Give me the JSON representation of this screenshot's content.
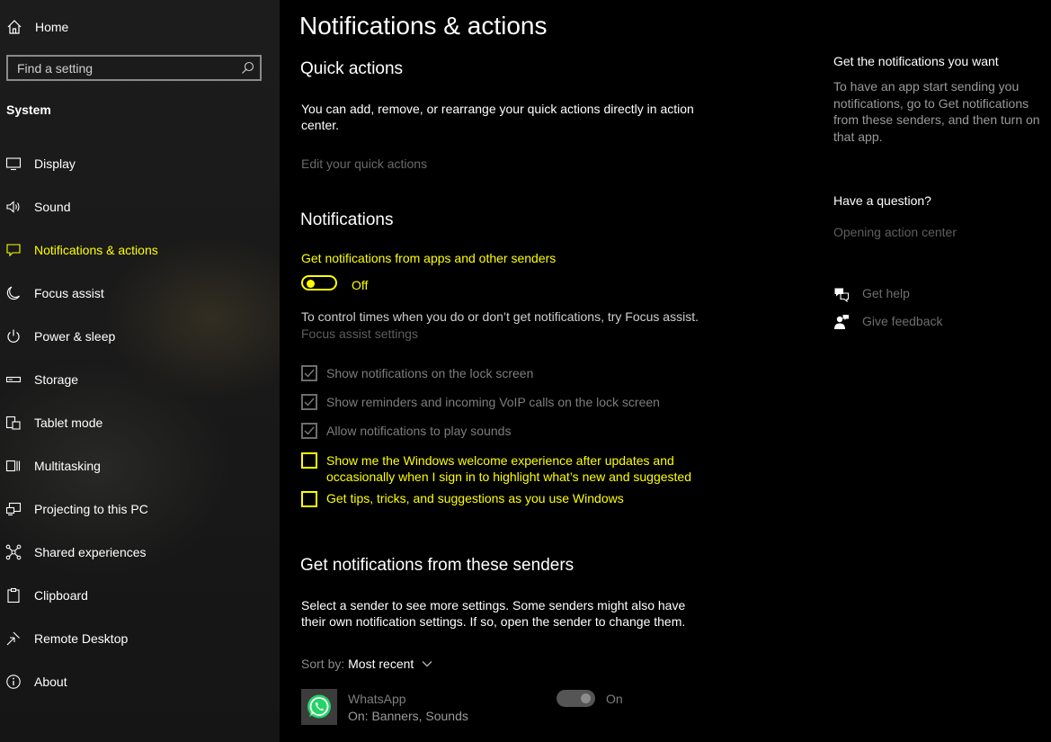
{
  "sidebar": {
    "home_label": "Home",
    "search_placeholder": "Find a setting",
    "section_label": "System",
    "items": [
      {
        "label": "Display",
        "icon": "monitor-icon"
      },
      {
        "label": "Sound",
        "icon": "speaker-icon"
      },
      {
        "label": "Notifications & actions",
        "icon": "message-icon",
        "active": true
      },
      {
        "label": "Focus assist",
        "icon": "moon-icon"
      },
      {
        "label": "Power & sleep",
        "icon": "power-icon"
      },
      {
        "label": "Storage",
        "icon": "storage-icon"
      },
      {
        "label": "Tablet mode",
        "icon": "tablet-icon"
      },
      {
        "label": "Multitasking",
        "icon": "multitasking-icon"
      },
      {
        "label": "Projecting to this PC",
        "icon": "projector-icon"
      },
      {
        "label": "Shared experiences",
        "icon": "share-icon"
      },
      {
        "label": "Clipboard",
        "icon": "clipboard-icon"
      },
      {
        "label": "Remote Desktop",
        "icon": "remote-desktop-icon"
      },
      {
        "label": "About",
        "icon": "info-icon"
      }
    ]
  },
  "main": {
    "title": "Notifications & actions",
    "quick_actions": {
      "heading": "Quick actions",
      "description": "You can add, remove, or rearrange your quick actions directly in action center.",
      "link": "Edit your quick actions"
    },
    "notifications": {
      "heading": "Notifications",
      "toggle_label": "Get notifications from apps and other senders",
      "toggle_state": "Off",
      "focus_text": "To control times when you do or don’t get notifications, try Focus assist.",
      "focus_link": "Focus assist settings",
      "checkboxes": [
        {
          "label": "Show notifications on the lock screen",
          "checked": true,
          "enabled": false
        },
        {
          "label": "Show reminders and incoming VoIP calls on the lock screen",
          "checked": true,
          "enabled": false
        },
        {
          "label": "Allow notifications to play sounds",
          "checked": true,
          "enabled": false
        },
        {
          "label": "Show me the Windows welcome experience after updates and occasionally when I sign in to highlight what’s new and suggested",
          "checked": false,
          "enabled": true
        },
        {
          "label": "Get tips, tricks, and suggestions as you use Windows",
          "checked": false,
          "enabled": true
        }
      ]
    },
    "senders": {
      "heading": "Get notifications from these senders",
      "description": "Select a sender to see more settings. Some senders might also have their own notification settings. If so, open the sender to change them.",
      "sort_label": "Sort by:",
      "sort_value": "Most recent",
      "items": [
        {
          "name": "WhatsApp",
          "detail": "On: Banners, Sounds",
          "state": "On",
          "icon": "whatsapp-icon"
        }
      ]
    }
  },
  "right": {
    "get_heading": "Get the notifications you want",
    "get_text": "To have an app start sending you notifications, go to Get notifications from these senders, and then turn on that app.",
    "question_heading": "Have a question?",
    "question_link": "Opening action center",
    "help_link": "Get help",
    "feedback_link": "Give feedback"
  },
  "colors": {
    "accent": "#ffff00",
    "background": "#000000",
    "sidebar": "#1a1a1a",
    "muted_text": "#7a7a7a"
  }
}
